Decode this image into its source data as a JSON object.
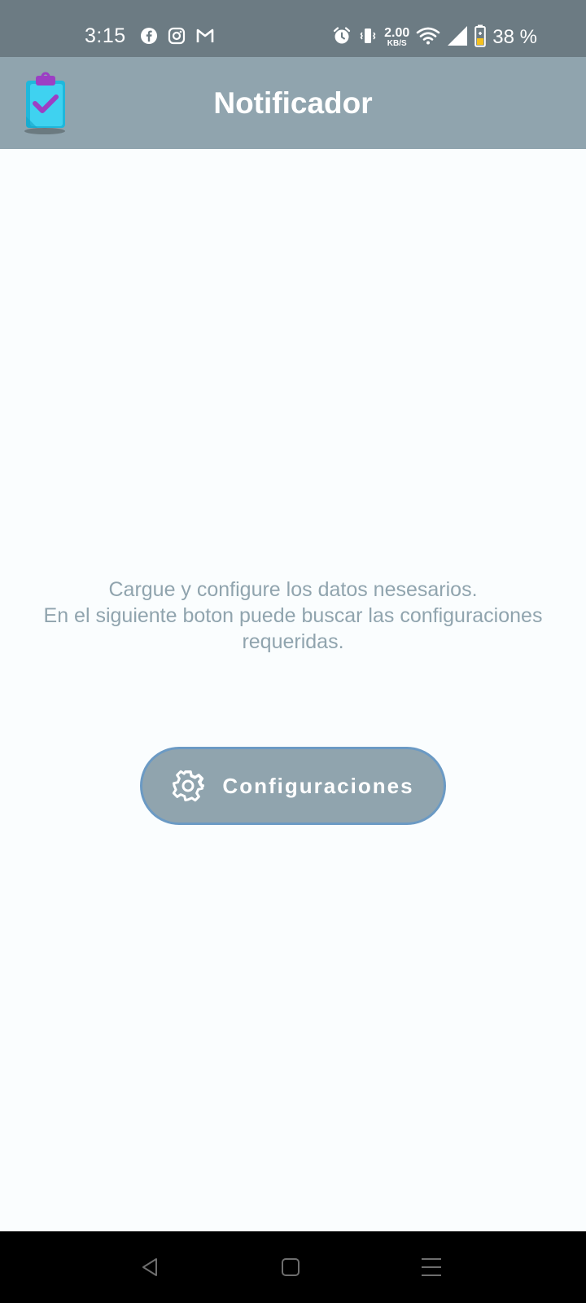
{
  "status_bar": {
    "time": "3:15",
    "net_speed_value": "2.00",
    "net_speed_unit": "KB/S",
    "battery_percent": "38 %",
    "icons": [
      "facebook-icon",
      "instagram-icon",
      "gmail-icon",
      "alarm-icon",
      "vibrate-icon",
      "wifi-icon",
      "signal-icon",
      "battery-icon"
    ]
  },
  "app_bar": {
    "title": "Notificador",
    "logo_icon": "clipboard-check-icon"
  },
  "main": {
    "info_lines": [
      "Cargue y configure los datos nesesarios.",
      "En el siguiente boton puede buscar las configuraciones",
      "requeridas."
    ],
    "config_button": {
      "label": "Configuraciones",
      "icon": "gear-icon"
    }
  },
  "nav_bar": {
    "buttons": [
      "back-icon",
      "home-icon",
      "menu-icon"
    ]
  },
  "colors": {
    "status_bar_bg": "#6c7b83",
    "app_bar_bg": "#90a4ae",
    "page_bg": "#fafdfe",
    "text_muted": "#90a4ae",
    "button_bg": "#90a4ae",
    "button_border": "#6b9ac4",
    "nav_bg": "#000000"
  }
}
